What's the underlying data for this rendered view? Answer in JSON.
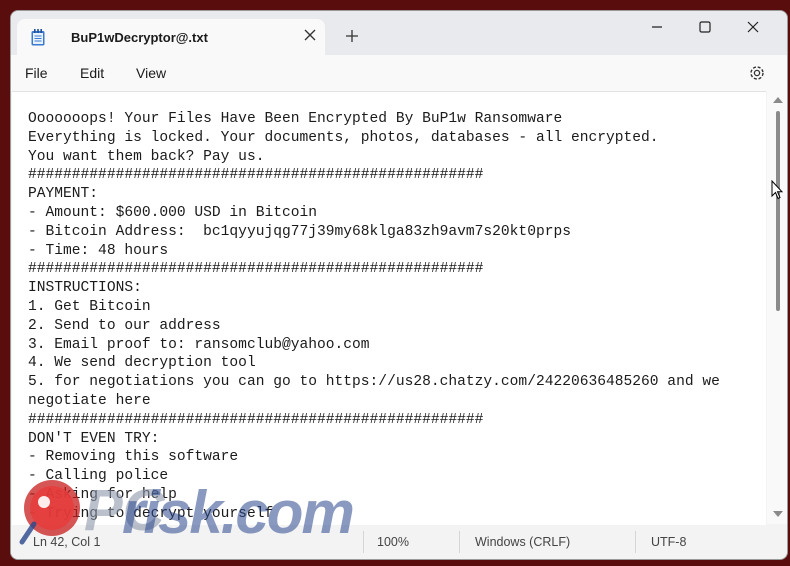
{
  "tab": {
    "title": "BuP1wDecryptor@.txt"
  },
  "menu": {
    "file": "File",
    "edit": "Edit",
    "view": "View"
  },
  "editor": {
    "text": "Ooooooops! Your Files Have Been Encrypted By BuP1w Ransomware\nEverything is locked. Your documents, photos, databases - all encrypted.\nYou want them back? Pay us.\n####################################################\nPAYMENT:\n- Amount: $600.000 USD in Bitcoin\n- Bitcoin Address:  bc1qyyujqg77j39my68klga83zh9avm7s20kt0prps\n- Time: 48 hours\n####################################################\nINSTRUCTIONS:\n1. Get Bitcoin\n2. Send to our address\n3. Email proof to: ransomclub@yahoo.com\n4. We send decryption tool\n5. for negotiations you can go to https://us28.chatzy.com/24220636485260 and we\nnegotiate here\n####################################################\nDON'T EVEN TRY:\n- Removing this software\n- Calling police\n- Asking for help\n- Trying to decrypt yourself"
  },
  "status": {
    "position": "Ln 42, Col 1",
    "zoom": "100%",
    "line_ending": "Windows (CRLF)",
    "encoding": "UTF-8"
  },
  "watermark": {
    "text": "risk.com"
  },
  "colors": {
    "background": "#5a0d0d",
    "window": "#f3f3f3",
    "editor": "#ffffff",
    "watermark": "#28468c"
  },
  "icons": [
    "notepad-icon",
    "close-icon",
    "plus-icon",
    "minimize-icon",
    "maximize-icon",
    "settings-icon",
    "mouse-cursor-icon",
    "pcrisk-logo-icon"
  ]
}
